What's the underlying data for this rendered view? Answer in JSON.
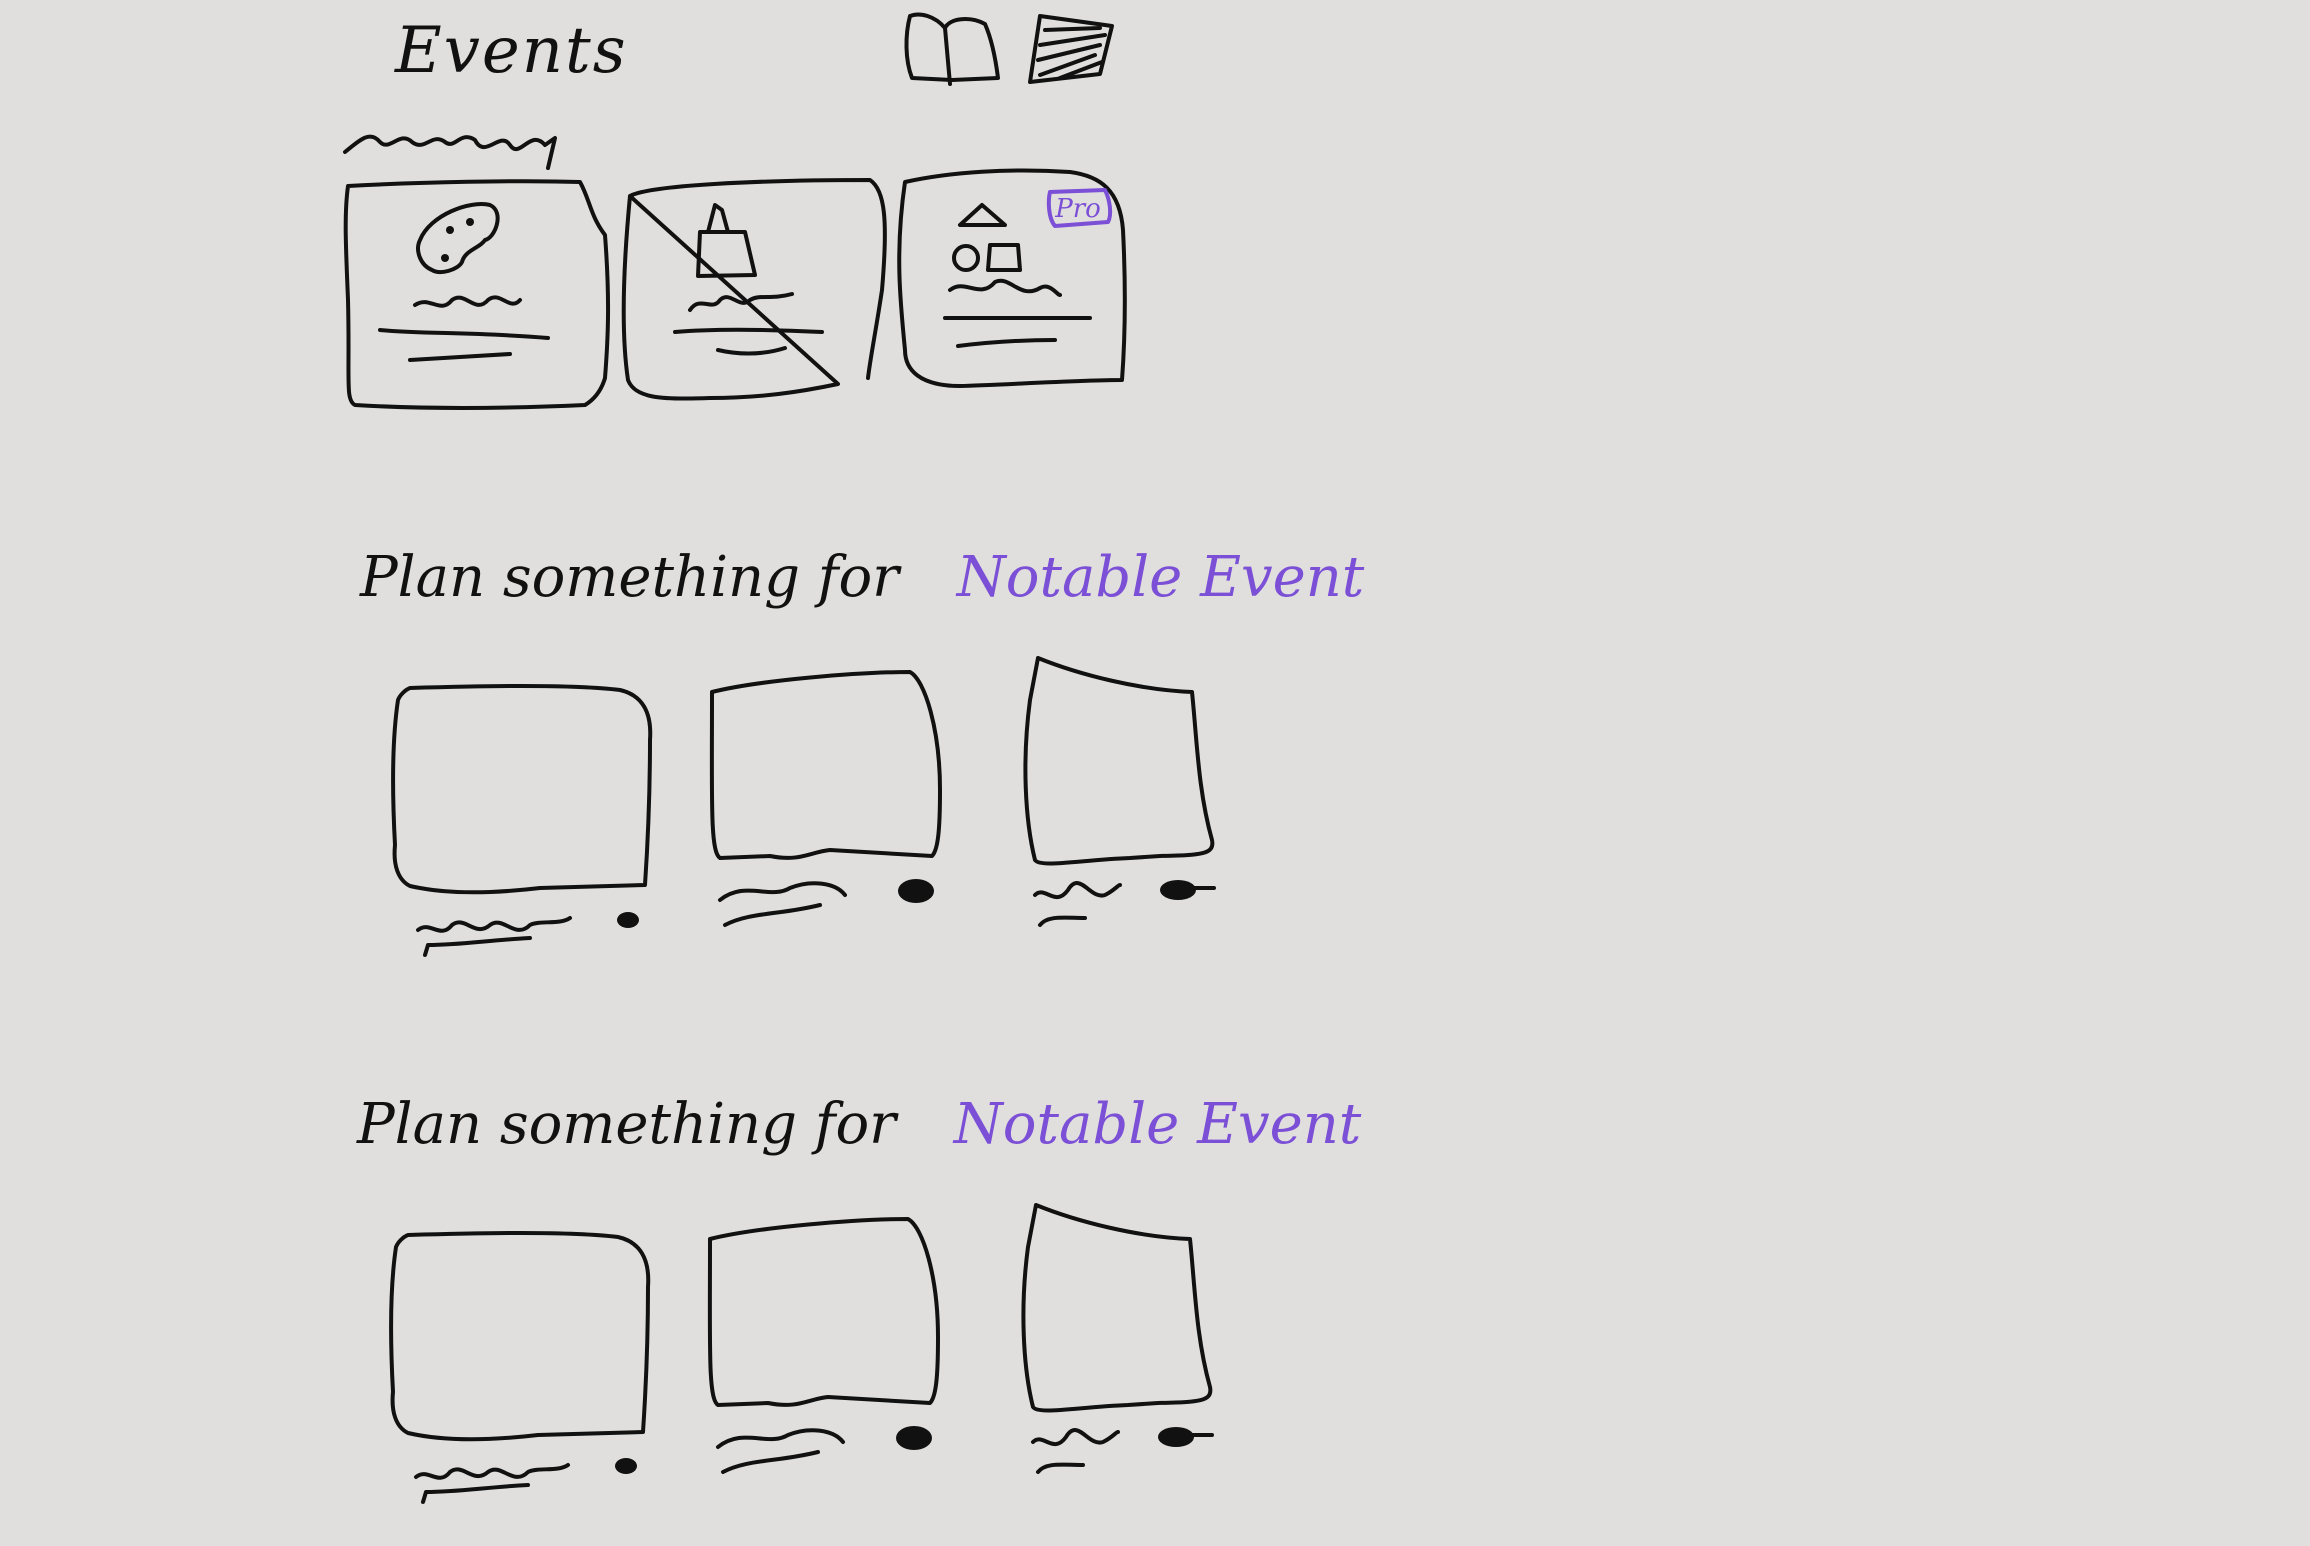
{
  "header": {
    "title": "Events",
    "subtitle_scribble": "~~~"
  },
  "toolbar": {
    "icons": [
      "book-icon",
      "calendar-icon"
    ]
  },
  "featured": {
    "cards": [
      {
        "icon": "palette-icon",
        "badge": ""
      },
      {
        "icon": "easel-icon",
        "badge": ""
      },
      {
        "icon": "shapes-icon",
        "badge": "Pro"
      }
    ]
  },
  "sections": [
    {
      "prefix": "Plan something for",
      "highlight": "Notable Event"
    },
    {
      "prefix": "Plan something for",
      "highlight": "Notable Event"
    }
  ],
  "colors": {
    "background": "#e0dfde",
    "ink": "#111111",
    "accent": "#7b4fd6"
  }
}
